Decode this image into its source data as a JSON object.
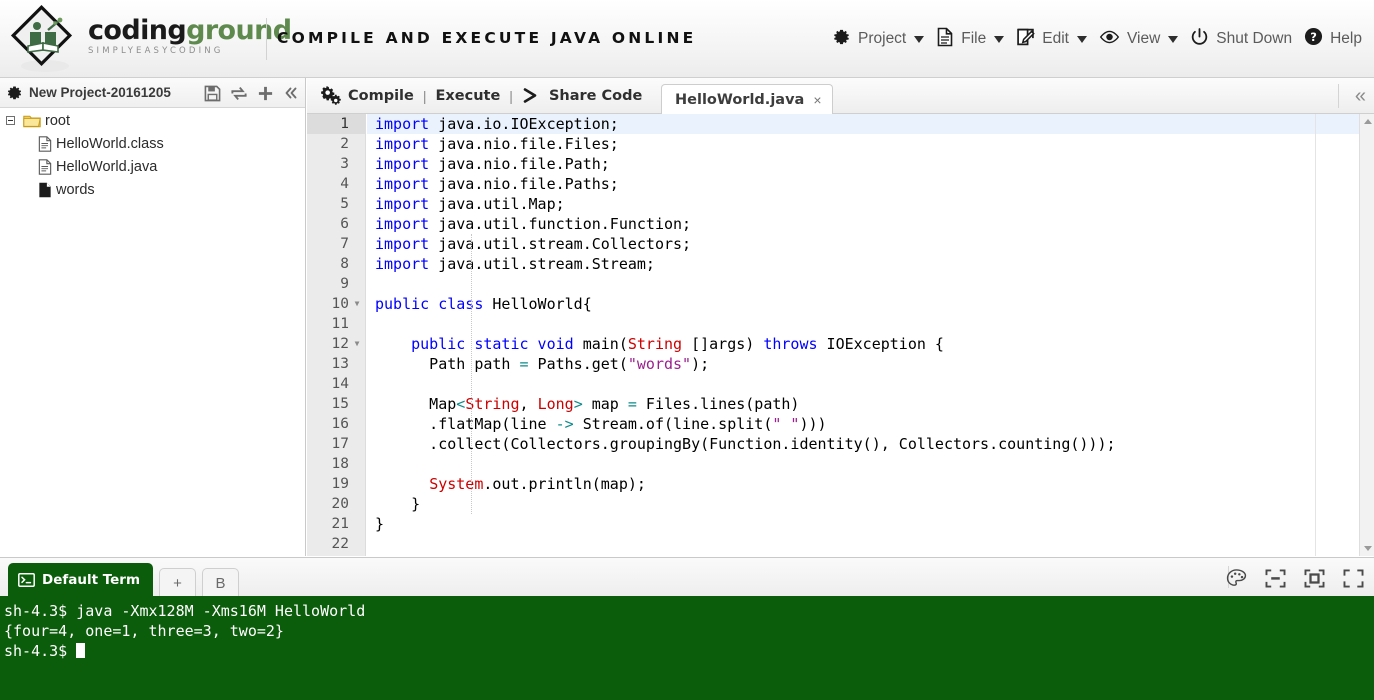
{
  "header": {
    "logo": {
      "word1": "coding",
      "word2": "ground",
      "tagline": "SIMPLYEASYCODING",
      "icon": "book-diamond-logo"
    },
    "page_title": "COMPILE AND EXECUTE JAVA ONLINE",
    "menu": [
      {
        "label": "Project",
        "icon": "gear-icon",
        "caret": true
      },
      {
        "label": "File",
        "icon": "document-icon",
        "caret": true
      },
      {
        "label": "Edit",
        "icon": "edit-pencil-icon",
        "caret": true
      },
      {
        "label": "View",
        "icon": "eye-icon",
        "caret": true
      },
      {
        "label": "Shut Down",
        "icon": "power-icon",
        "caret": false
      },
      {
        "label": "Help",
        "icon": "question-circle-icon",
        "caret": false
      }
    ]
  },
  "sidebar": {
    "project_name": "New Project-20161205",
    "project_icon": "gear-icon",
    "tools": [
      {
        "name": "save-icon",
        "title": "Save"
      },
      {
        "name": "refresh-icon",
        "title": "Refresh"
      },
      {
        "name": "add-icon",
        "title": "Add"
      },
      {
        "name": "collapse-icon",
        "title": "Collapse"
      }
    ],
    "tree": [
      {
        "label": "root",
        "icon": "folder-icon",
        "depth": 0,
        "expandable": true
      },
      {
        "label": "HelloWorld.class",
        "icon": "file-lines-icon",
        "depth": 1,
        "expandable": false
      },
      {
        "label": "HelloWorld.java",
        "icon": "file-lines-icon",
        "depth": 1,
        "expandable": false
      },
      {
        "label": "words",
        "icon": "file-plain-icon",
        "depth": 1,
        "expandable": false
      }
    ]
  },
  "editor": {
    "actions": [
      {
        "label": "Compile",
        "icon": "gears-icon"
      },
      {
        "label": "Execute",
        "icon": null
      },
      {
        "label": "Share Code",
        "icon": "chevron-right-icon"
      }
    ],
    "separator": "|",
    "tab": {
      "label": "HelloWorld.java",
      "close": "×"
    },
    "collapse_icon": "double-chevron-left-icon",
    "active_line": 1,
    "fold_lines": [
      10,
      12
    ],
    "lines": [
      {
        "n": 1,
        "tokens": [
          {
            "t": "import",
            "c": "kw"
          },
          {
            "t": " java.io.IOException;",
            "c": ""
          }
        ]
      },
      {
        "n": 2,
        "tokens": [
          {
            "t": "import",
            "c": "kw"
          },
          {
            "t": " java.nio.file.Files;",
            "c": ""
          }
        ]
      },
      {
        "n": 3,
        "tokens": [
          {
            "t": "import",
            "c": "kw"
          },
          {
            "t": " java.nio.file.Path;",
            "c": ""
          }
        ]
      },
      {
        "n": 4,
        "tokens": [
          {
            "t": "import",
            "c": "kw"
          },
          {
            "t": " java.nio.file.Paths;",
            "c": ""
          }
        ]
      },
      {
        "n": 5,
        "tokens": [
          {
            "t": "import",
            "c": "kw"
          },
          {
            "t": " java.util.Map;",
            "c": ""
          }
        ]
      },
      {
        "n": 6,
        "tokens": [
          {
            "t": "import",
            "c": "kw"
          },
          {
            "t": " java.util.function.Function;",
            "c": ""
          }
        ]
      },
      {
        "n": 7,
        "tokens": [
          {
            "t": "import",
            "c": "kw"
          },
          {
            "t": " java.util.stream.Collectors;",
            "c": ""
          }
        ]
      },
      {
        "n": 8,
        "tokens": [
          {
            "t": "import",
            "c": "kw"
          },
          {
            "t": " java.util.stream.Stream;",
            "c": ""
          }
        ]
      },
      {
        "n": 9,
        "tokens": []
      },
      {
        "n": 10,
        "tokens": [
          {
            "t": "public class",
            "c": "kw"
          },
          {
            "t": " HelloWorld{",
            "c": ""
          }
        ]
      },
      {
        "n": 11,
        "tokens": []
      },
      {
        "n": 12,
        "tokens": [
          {
            "t": "    ",
            "c": ""
          },
          {
            "t": "public static void",
            "c": "kw"
          },
          {
            "t": " main(",
            "c": ""
          },
          {
            "t": "String",
            "c": "typ"
          },
          {
            "t": " []args) ",
            "c": ""
          },
          {
            "t": "throws",
            "c": "kw"
          },
          {
            "t": " IOException {",
            "c": ""
          }
        ]
      },
      {
        "n": 13,
        "tokens": [
          {
            "t": "      Path path ",
            "c": ""
          },
          {
            "t": "=",
            "c": "op"
          },
          {
            "t": " Paths.get(",
            "c": ""
          },
          {
            "t": "\"words\"",
            "c": "str"
          },
          {
            "t": ");",
            "c": ""
          }
        ]
      },
      {
        "n": 14,
        "tokens": []
      },
      {
        "n": 15,
        "tokens": [
          {
            "t": "      Map",
            "c": ""
          },
          {
            "t": "<",
            "c": "op"
          },
          {
            "t": "String",
            "c": "typ"
          },
          {
            "t": ", ",
            "c": ""
          },
          {
            "t": "Long",
            "c": "typ"
          },
          {
            "t": ">",
            "c": "op"
          },
          {
            "t": " map ",
            "c": ""
          },
          {
            "t": "=",
            "c": "op"
          },
          {
            "t": " Files.lines(path)",
            "c": ""
          }
        ]
      },
      {
        "n": 16,
        "tokens": [
          {
            "t": "      .flatMap(line ",
            "c": ""
          },
          {
            "t": "->",
            "c": "arw"
          },
          {
            "t": " Stream.of(line.split(",
            "c": ""
          },
          {
            "t": "\" \"",
            "c": "str"
          },
          {
            "t": ")))",
            "c": ""
          }
        ]
      },
      {
        "n": 17,
        "tokens": [
          {
            "t": "      .collect(Collectors.groupingBy(Function.identity(), Collectors.counting()));",
            "c": ""
          }
        ]
      },
      {
        "n": 18,
        "tokens": []
      },
      {
        "n": 19,
        "tokens": [
          {
            "t": "      ",
            "c": ""
          },
          {
            "t": "System",
            "c": "typ"
          },
          {
            "t": ".out.println(map);",
            "c": ""
          }
        ]
      },
      {
        "n": 20,
        "tokens": [
          {
            "t": "    }",
            "c": ""
          }
        ]
      },
      {
        "n": 21,
        "tokens": [
          {
            "t": "}",
            "c": ""
          }
        ]
      },
      {
        "n": 22,
        "tokens": []
      }
    ]
  },
  "terminal": {
    "tabs": [
      {
        "label": "Default Term",
        "icon": "terminal-icon",
        "active": true
      },
      {
        "label": "+",
        "icon": null,
        "active": false
      },
      {
        "label": "B",
        "icon": null,
        "active": false
      }
    ],
    "icons": [
      {
        "name": "palette-icon"
      },
      {
        "name": "minimize-panel-icon"
      },
      {
        "name": "restore-panel-icon"
      },
      {
        "name": "fullscreen-icon"
      }
    ],
    "lines": [
      "sh-4.3$ java -Xmx128M -Xms16M HelloWorld",
      "{four=4, one=1, three=3, two=2}",
      "sh-4.3$ "
    ],
    "cursor_visible": true
  },
  "colors": {
    "terminal_bg": "#0b5c0b",
    "keyword": "#0000ff",
    "type": "#cc0000",
    "string": "#9b1f8e",
    "operator": "#0f8a8a",
    "logo_green": "#5f8a4e",
    "active_line": "#eaf2fd"
  }
}
